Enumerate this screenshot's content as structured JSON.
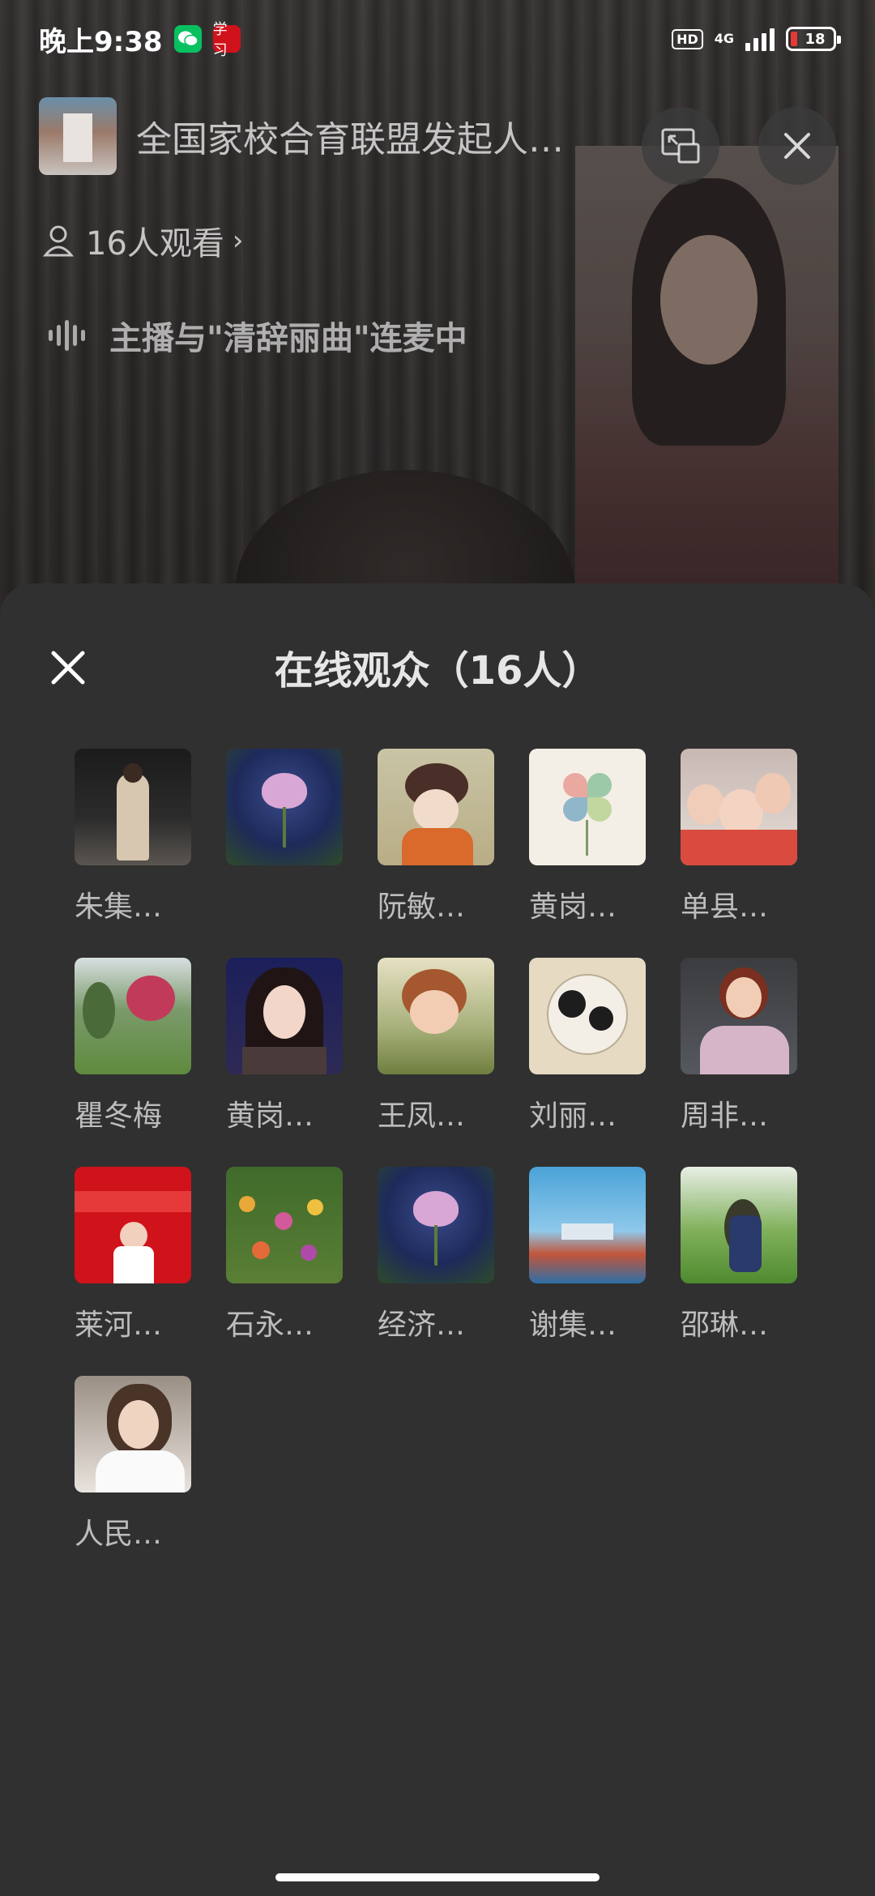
{
  "status_bar": {
    "time": "晚上9:38",
    "apps": [
      {
        "icon": "wechat-icon",
        "color": "#07c160"
      },
      {
        "icon": "xuexi-icon",
        "glyph": "学习",
        "color": "#d0121b"
      }
    ],
    "hd": "HD",
    "network": "4G",
    "battery": "18"
  },
  "live": {
    "title": "全国家校合育联盟发起人…",
    "viewers_label": "16人观看",
    "connect_text": "主播与\"清辞丽曲\"连麦中"
  },
  "sheet": {
    "title": "在线观众（16人）",
    "viewers": [
      {
        "name": "朱集…",
        "avatar": "person-standing-dark"
      },
      {
        "name": "",
        "avatar": "lotus-flower"
      },
      {
        "name": "阮敏…",
        "avatar": "cartoon-girl"
      },
      {
        "name": "黄岗…",
        "avatar": "clover-painting"
      },
      {
        "name": "单县…",
        "avatar": "family-photo"
      },
      {
        "name": "瞿冬梅",
        "avatar": "garden-flowers"
      },
      {
        "name": "黄岗…",
        "avatar": "woman-portrait"
      },
      {
        "name": "王凤…",
        "avatar": "child-girl"
      },
      {
        "name": "刘丽…",
        "avatar": "panda-painting"
      },
      {
        "name": "周非…",
        "avatar": "woman-office"
      },
      {
        "name": "莱河…",
        "avatar": "red-banner-speaker"
      },
      {
        "name": "石永…",
        "avatar": "flower-bed"
      },
      {
        "name": "经济…",
        "avatar": "lotus-flower"
      },
      {
        "name": "谢集…",
        "avatar": "running-track"
      },
      {
        "name": "邵琳…",
        "avatar": "woman-swing"
      },
      {
        "name": "人民…",
        "avatar": "woman-white-shirt"
      }
    ]
  },
  "colors": {
    "sheet_bg": "#303030",
    "name_text": "#bdbdbd",
    "title_text": "#e6e6e6"
  }
}
